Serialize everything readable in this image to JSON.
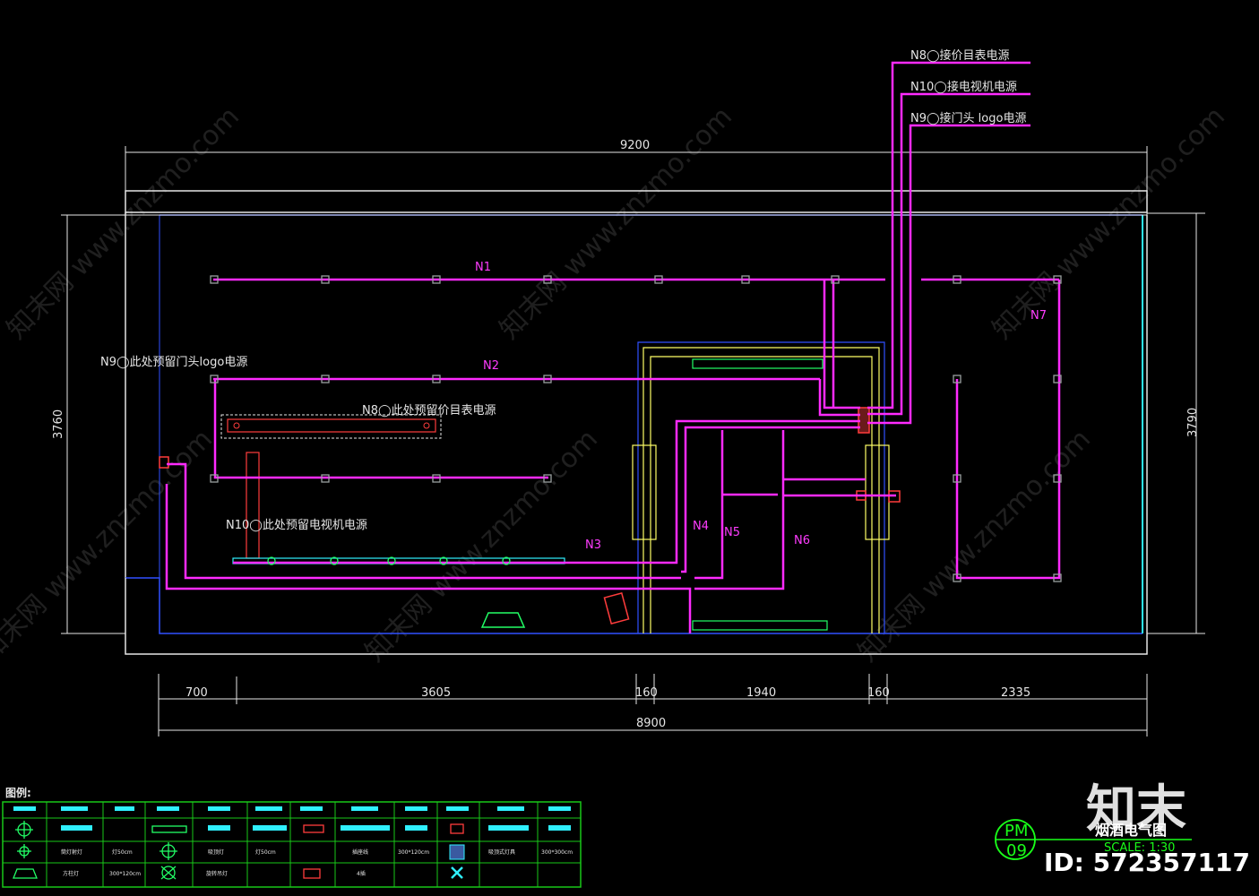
{
  "dimensions": {
    "top_total": "9200",
    "bottom_total": "8900",
    "left_height": "3760",
    "right_height": "3790",
    "segments": [
      "700",
      "3605",
      "160",
      "1940",
      "160",
      "2335"
    ]
  },
  "circuits": {
    "n1": "N1",
    "n2": "N2",
    "n3": "N3",
    "n4": "N4",
    "n5": "N5",
    "n6": "N6",
    "n7": "N7"
  },
  "annotations": {
    "top_n8": "N8◯接价目表电源",
    "top_n10": "N10◯接电视机电源",
    "top_n9": "N9◯接门头 logo电源",
    "reserve_n9": "N9◯此处预留门头logo电源",
    "reserve_n8": "N8◯此处预留价目表电源",
    "reserve_n10": "N10◯此处预留电视机电源"
  },
  "legend": {
    "title": "图例:",
    "items": [
      "筒灯射灯",
      "灯50cm",
      "吸顶灯",
      "灯50cm",
      "插座线",
      "300*120cm",
      "吸顶式灯具",
      "300*300cm",
      "方柱灯",
      "300*120cm",
      "旋转吊灯",
      "4插"
    ]
  },
  "title_block": {
    "code_top": "PM",
    "code_bottom": "09",
    "drawing_title": "烟酒电气图",
    "scale": "SCALE: 1:30"
  },
  "watermark": {
    "text": "知末网 www.znzmo.com",
    "brand": "知末",
    "id": "ID: 572357117"
  },
  "colors": {
    "background": "#000000",
    "circuit": "#ff2bff",
    "wall": "#e6e6e6",
    "counter": "#ffff66",
    "glass": "#2ff0ff",
    "dimension_text": "#e6e6e6",
    "legend_frame": "#19c819"
  }
}
